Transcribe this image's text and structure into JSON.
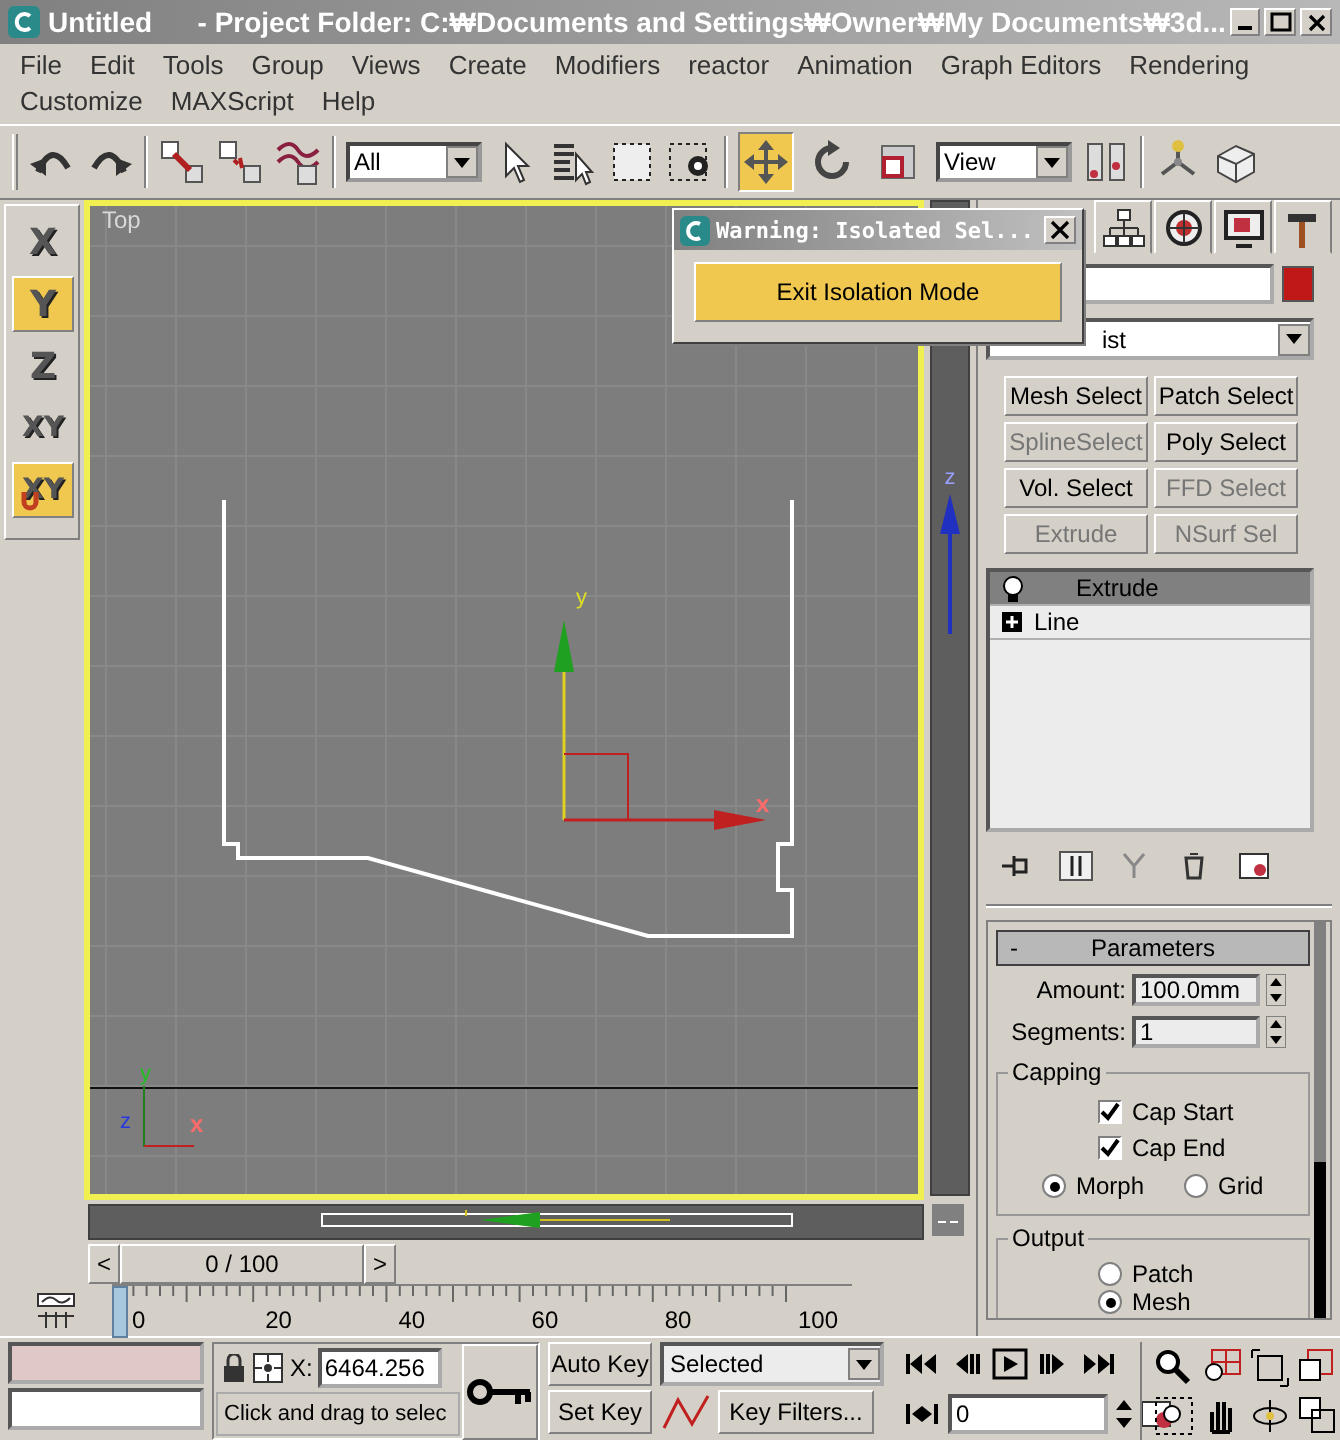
{
  "window": {
    "title": "Untitled",
    "project_folder": "- Project Folder: C:₩Documents and Settings₩Owner₩My Documents₩3d..."
  },
  "menu": [
    "File",
    "Edit",
    "Tools",
    "Group",
    "Views",
    "Create",
    "Modifiers",
    "reactor",
    "Animation",
    "Graph Editors",
    "Rendering",
    "Customize",
    "MAXScript",
    "Help"
  ],
  "main_toolbar": {
    "selection_filter": "All",
    "reference_coordinate_system": "View",
    "transform_tools": [
      {
        "selected": true
      },
      {
        "selected": false
      },
      {
        "selected": false
      }
    ]
  },
  "axis_constraints": [
    {
      "label": "X",
      "selected": false,
      "kind": "axis"
    },
    {
      "label": "Y",
      "selected": true,
      "kind": "axis"
    },
    {
      "label": "Z",
      "selected": false,
      "kind": "axis"
    },
    {
      "label": "XY",
      "selected": false,
      "kind": "axis"
    },
    {
      "label": "XY",
      "selected": true,
      "kind": "snap"
    }
  ],
  "viewport": {
    "label": "Top",
    "gizmo": {
      "x_label": "x",
      "y_label": "y"
    },
    "axis_tripod": {
      "x_label": "x",
      "y_label": "y",
      "z_label": "z"
    },
    "z_slider_label": "z"
  },
  "dialog": {
    "title": "Warning: Isolated Sel...",
    "button": "Exit Isolation Mode"
  },
  "command_panel": {
    "modifier_list": "ist",
    "modifier_buttons": [
      {
        "label": "Mesh Select",
        "disabled": false
      },
      {
        "label": "Patch Select",
        "disabled": false
      },
      {
        "label": "SplineSelect",
        "disabled": true
      },
      {
        "label": "Poly Select",
        "disabled": false
      },
      {
        "label": "Vol. Select",
        "disabled": false
      },
      {
        "label": "FFD Select",
        "disabled": true
      },
      {
        "label": "Extrude",
        "disabled": true
      },
      {
        "label": "NSurf Sel",
        "disabled": true
      }
    ],
    "stack": [
      {
        "label": "Extrude",
        "selected": true,
        "kind": "modifier"
      },
      {
        "label": "Line",
        "selected": false,
        "kind": "object"
      }
    ],
    "parameters": {
      "title": "Parameters",
      "collapse": "-",
      "fields": [
        {
          "label": "Amount:",
          "value": "100.0mm"
        },
        {
          "label": "Segments:",
          "value": "1"
        }
      ],
      "capping": {
        "title": "Capping",
        "options": [
          {
            "label": "Cap Start",
            "checked": true
          },
          {
            "label": "Cap End",
            "checked": true
          }
        ],
        "methods": [
          {
            "label": "Morph",
            "selected": true
          },
          {
            "label": "Grid",
            "selected": false
          }
        ]
      },
      "output": {
        "title": "Output",
        "options": [
          {
            "label": "Patch",
            "selected": false
          },
          {
            "label": "Mesh",
            "selected": true
          }
        ]
      }
    }
  },
  "time_slider": {
    "position": "0 / 100",
    "prev": "<",
    "next": ">"
  },
  "track_bar": {
    "ticks": [
      "0",
      "20",
      "40",
      "60",
      "80",
      "100"
    ]
  },
  "status_bar": {
    "x_label": "X:",
    "x_value": "6464.256",
    "prompt": "Click and drag to selec",
    "auto_key": "Auto Key",
    "set_key": "Set Key",
    "key_mode": "Selected",
    "key_filters": "Key Filters...",
    "frame": "0"
  }
}
